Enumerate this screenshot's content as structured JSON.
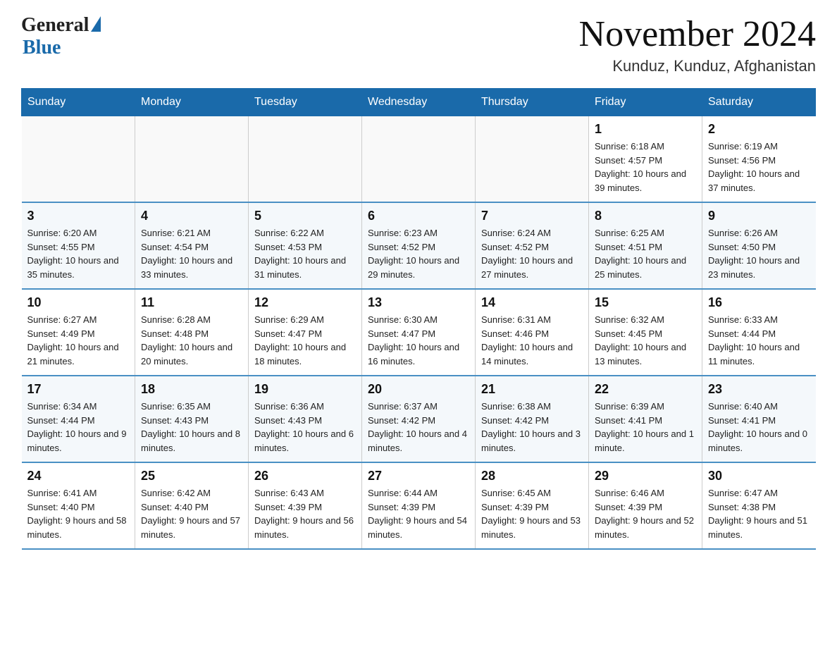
{
  "header": {
    "logo_general": "General",
    "logo_blue": "Blue",
    "month_title": "November 2024",
    "location": "Kunduz, Kunduz, Afghanistan"
  },
  "days_of_week": [
    "Sunday",
    "Monday",
    "Tuesday",
    "Wednesday",
    "Thursday",
    "Friday",
    "Saturday"
  ],
  "weeks": [
    [
      {
        "day": "",
        "sunrise": "",
        "sunset": "",
        "daylight": ""
      },
      {
        "day": "",
        "sunrise": "",
        "sunset": "",
        "daylight": ""
      },
      {
        "day": "",
        "sunrise": "",
        "sunset": "",
        "daylight": ""
      },
      {
        "day": "",
        "sunrise": "",
        "sunset": "",
        "daylight": ""
      },
      {
        "day": "",
        "sunrise": "",
        "sunset": "",
        "daylight": ""
      },
      {
        "day": "1",
        "sunrise": "Sunrise: 6:18 AM",
        "sunset": "Sunset: 4:57 PM",
        "daylight": "Daylight: 10 hours and 39 minutes."
      },
      {
        "day": "2",
        "sunrise": "Sunrise: 6:19 AM",
        "sunset": "Sunset: 4:56 PM",
        "daylight": "Daylight: 10 hours and 37 minutes."
      }
    ],
    [
      {
        "day": "3",
        "sunrise": "Sunrise: 6:20 AM",
        "sunset": "Sunset: 4:55 PM",
        "daylight": "Daylight: 10 hours and 35 minutes."
      },
      {
        "day": "4",
        "sunrise": "Sunrise: 6:21 AM",
        "sunset": "Sunset: 4:54 PM",
        "daylight": "Daylight: 10 hours and 33 minutes."
      },
      {
        "day": "5",
        "sunrise": "Sunrise: 6:22 AM",
        "sunset": "Sunset: 4:53 PM",
        "daylight": "Daylight: 10 hours and 31 minutes."
      },
      {
        "day": "6",
        "sunrise": "Sunrise: 6:23 AM",
        "sunset": "Sunset: 4:52 PM",
        "daylight": "Daylight: 10 hours and 29 minutes."
      },
      {
        "day": "7",
        "sunrise": "Sunrise: 6:24 AM",
        "sunset": "Sunset: 4:52 PM",
        "daylight": "Daylight: 10 hours and 27 minutes."
      },
      {
        "day": "8",
        "sunrise": "Sunrise: 6:25 AM",
        "sunset": "Sunset: 4:51 PM",
        "daylight": "Daylight: 10 hours and 25 minutes."
      },
      {
        "day": "9",
        "sunrise": "Sunrise: 6:26 AM",
        "sunset": "Sunset: 4:50 PM",
        "daylight": "Daylight: 10 hours and 23 minutes."
      }
    ],
    [
      {
        "day": "10",
        "sunrise": "Sunrise: 6:27 AM",
        "sunset": "Sunset: 4:49 PM",
        "daylight": "Daylight: 10 hours and 21 minutes."
      },
      {
        "day": "11",
        "sunrise": "Sunrise: 6:28 AM",
        "sunset": "Sunset: 4:48 PM",
        "daylight": "Daylight: 10 hours and 20 minutes."
      },
      {
        "day": "12",
        "sunrise": "Sunrise: 6:29 AM",
        "sunset": "Sunset: 4:47 PM",
        "daylight": "Daylight: 10 hours and 18 minutes."
      },
      {
        "day": "13",
        "sunrise": "Sunrise: 6:30 AM",
        "sunset": "Sunset: 4:47 PM",
        "daylight": "Daylight: 10 hours and 16 minutes."
      },
      {
        "day": "14",
        "sunrise": "Sunrise: 6:31 AM",
        "sunset": "Sunset: 4:46 PM",
        "daylight": "Daylight: 10 hours and 14 minutes."
      },
      {
        "day": "15",
        "sunrise": "Sunrise: 6:32 AM",
        "sunset": "Sunset: 4:45 PM",
        "daylight": "Daylight: 10 hours and 13 minutes."
      },
      {
        "day": "16",
        "sunrise": "Sunrise: 6:33 AM",
        "sunset": "Sunset: 4:44 PM",
        "daylight": "Daylight: 10 hours and 11 minutes."
      }
    ],
    [
      {
        "day": "17",
        "sunrise": "Sunrise: 6:34 AM",
        "sunset": "Sunset: 4:44 PM",
        "daylight": "Daylight: 10 hours and 9 minutes."
      },
      {
        "day": "18",
        "sunrise": "Sunrise: 6:35 AM",
        "sunset": "Sunset: 4:43 PM",
        "daylight": "Daylight: 10 hours and 8 minutes."
      },
      {
        "day": "19",
        "sunrise": "Sunrise: 6:36 AM",
        "sunset": "Sunset: 4:43 PM",
        "daylight": "Daylight: 10 hours and 6 minutes."
      },
      {
        "day": "20",
        "sunrise": "Sunrise: 6:37 AM",
        "sunset": "Sunset: 4:42 PM",
        "daylight": "Daylight: 10 hours and 4 minutes."
      },
      {
        "day": "21",
        "sunrise": "Sunrise: 6:38 AM",
        "sunset": "Sunset: 4:42 PM",
        "daylight": "Daylight: 10 hours and 3 minutes."
      },
      {
        "day": "22",
        "sunrise": "Sunrise: 6:39 AM",
        "sunset": "Sunset: 4:41 PM",
        "daylight": "Daylight: 10 hours and 1 minute."
      },
      {
        "day": "23",
        "sunrise": "Sunrise: 6:40 AM",
        "sunset": "Sunset: 4:41 PM",
        "daylight": "Daylight: 10 hours and 0 minutes."
      }
    ],
    [
      {
        "day": "24",
        "sunrise": "Sunrise: 6:41 AM",
        "sunset": "Sunset: 4:40 PM",
        "daylight": "Daylight: 9 hours and 58 minutes."
      },
      {
        "day": "25",
        "sunrise": "Sunrise: 6:42 AM",
        "sunset": "Sunset: 4:40 PM",
        "daylight": "Daylight: 9 hours and 57 minutes."
      },
      {
        "day": "26",
        "sunrise": "Sunrise: 6:43 AM",
        "sunset": "Sunset: 4:39 PM",
        "daylight": "Daylight: 9 hours and 56 minutes."
      },
      {
        "day": "27",
        "sunrise": "Sunrise: 6:44 AM",
        "sunset": "Sunset: 4:39 PM",
        "daylight": "Daylight: 9 hours and 54 minutes."
      },
      {
        "day": "28",
        "sunrise": "Sunrise: 6:45 AM",
        "sunset": "Sunset: 4:39 PM",
        "daylight": "Daylight: 9 hours and 53 minutes."
      },
      {
        "day": "29",
        "sunrise": "Sunrise: 6:46 AM",
        "sunset": "Sunset: 4:39 PM",
        "daylight": "Daylight: 9 hours and 52 minutes."
      },
      {
        "day": "30",
        "sunrise": "Sunrise: 6:47 AM",
        "sunset": "Sunset: 4:38 PM",
        "daylight": "Daylight: 9 hours and 51 minutes."
      }
    ]
  ]
}
